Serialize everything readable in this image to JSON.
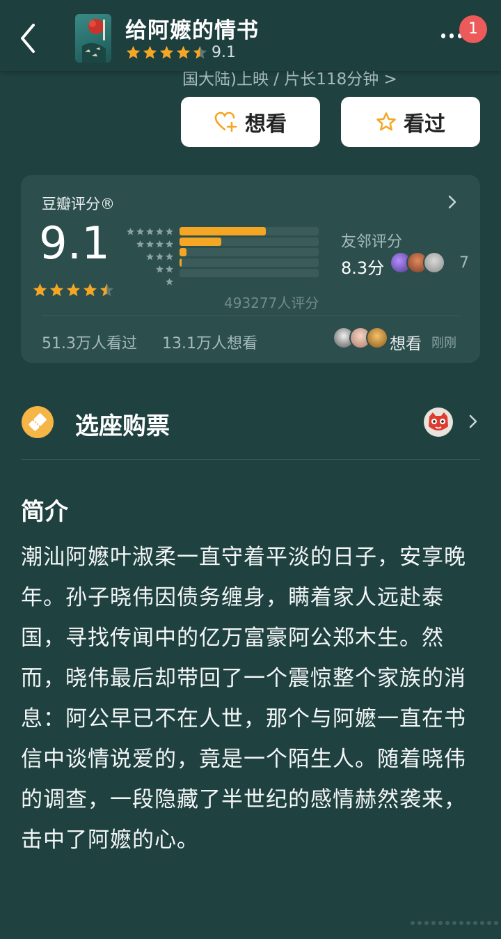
{
  "header": {
    "title": "给阿嬷的情书",
    "score": "9.1",
    "badge": "1"
  },
  "release_info": "国大陆)上映 / 片长118分钟 >",
  "actions": {
    "want_label": "想看",
    "seen_label": "看过"
  },
  "rating": {
    "title": "豆瓣评分®",
    "score": "9.1",
    "star_rating": 4.5,
    "distribution": [
      0.62,
      0.3,
      0.05,
      0.01,
      0.0
    ],
    "rating_count": "493277人评分",
    "friends_label": "友邻评分",
    "friends_score": "8.3分",
    "friends_count": "7",
    "seen_count": "51.3万人看过",
    "wish_count": "13.1万人想看",
    "recent_action": "想看",
    "recent_time": "刚刚"
  },
  "ticket": {
    "label": "选座购票"
  },
  "synopsis": {
    "title": "简介",
    "text": "潮汕阿嬷叶淑柔一直守着平淡的日子，安享晚年。孙子晓伟因债务缠身，瞒着家人远赴泰国，寻找传闻中的亿万富豪阿公郑木生。然而，晓伟最后却带回了一个震惊整个家族的消息：阿公早已不在人世，那个与阿嬷一直在书信中谈情说爱的，竟是一个陌生人。随着晓伟的调查，一段隐藏了半世纪的感情赫然袭来，击中了阿嬷的心。"
  },
  "colors": {
    "background": "#1f4140",
    "card": "#2c4e4d",
    "star": "#f5a623",
    "badge": "#ec5a5a"
  }
}
